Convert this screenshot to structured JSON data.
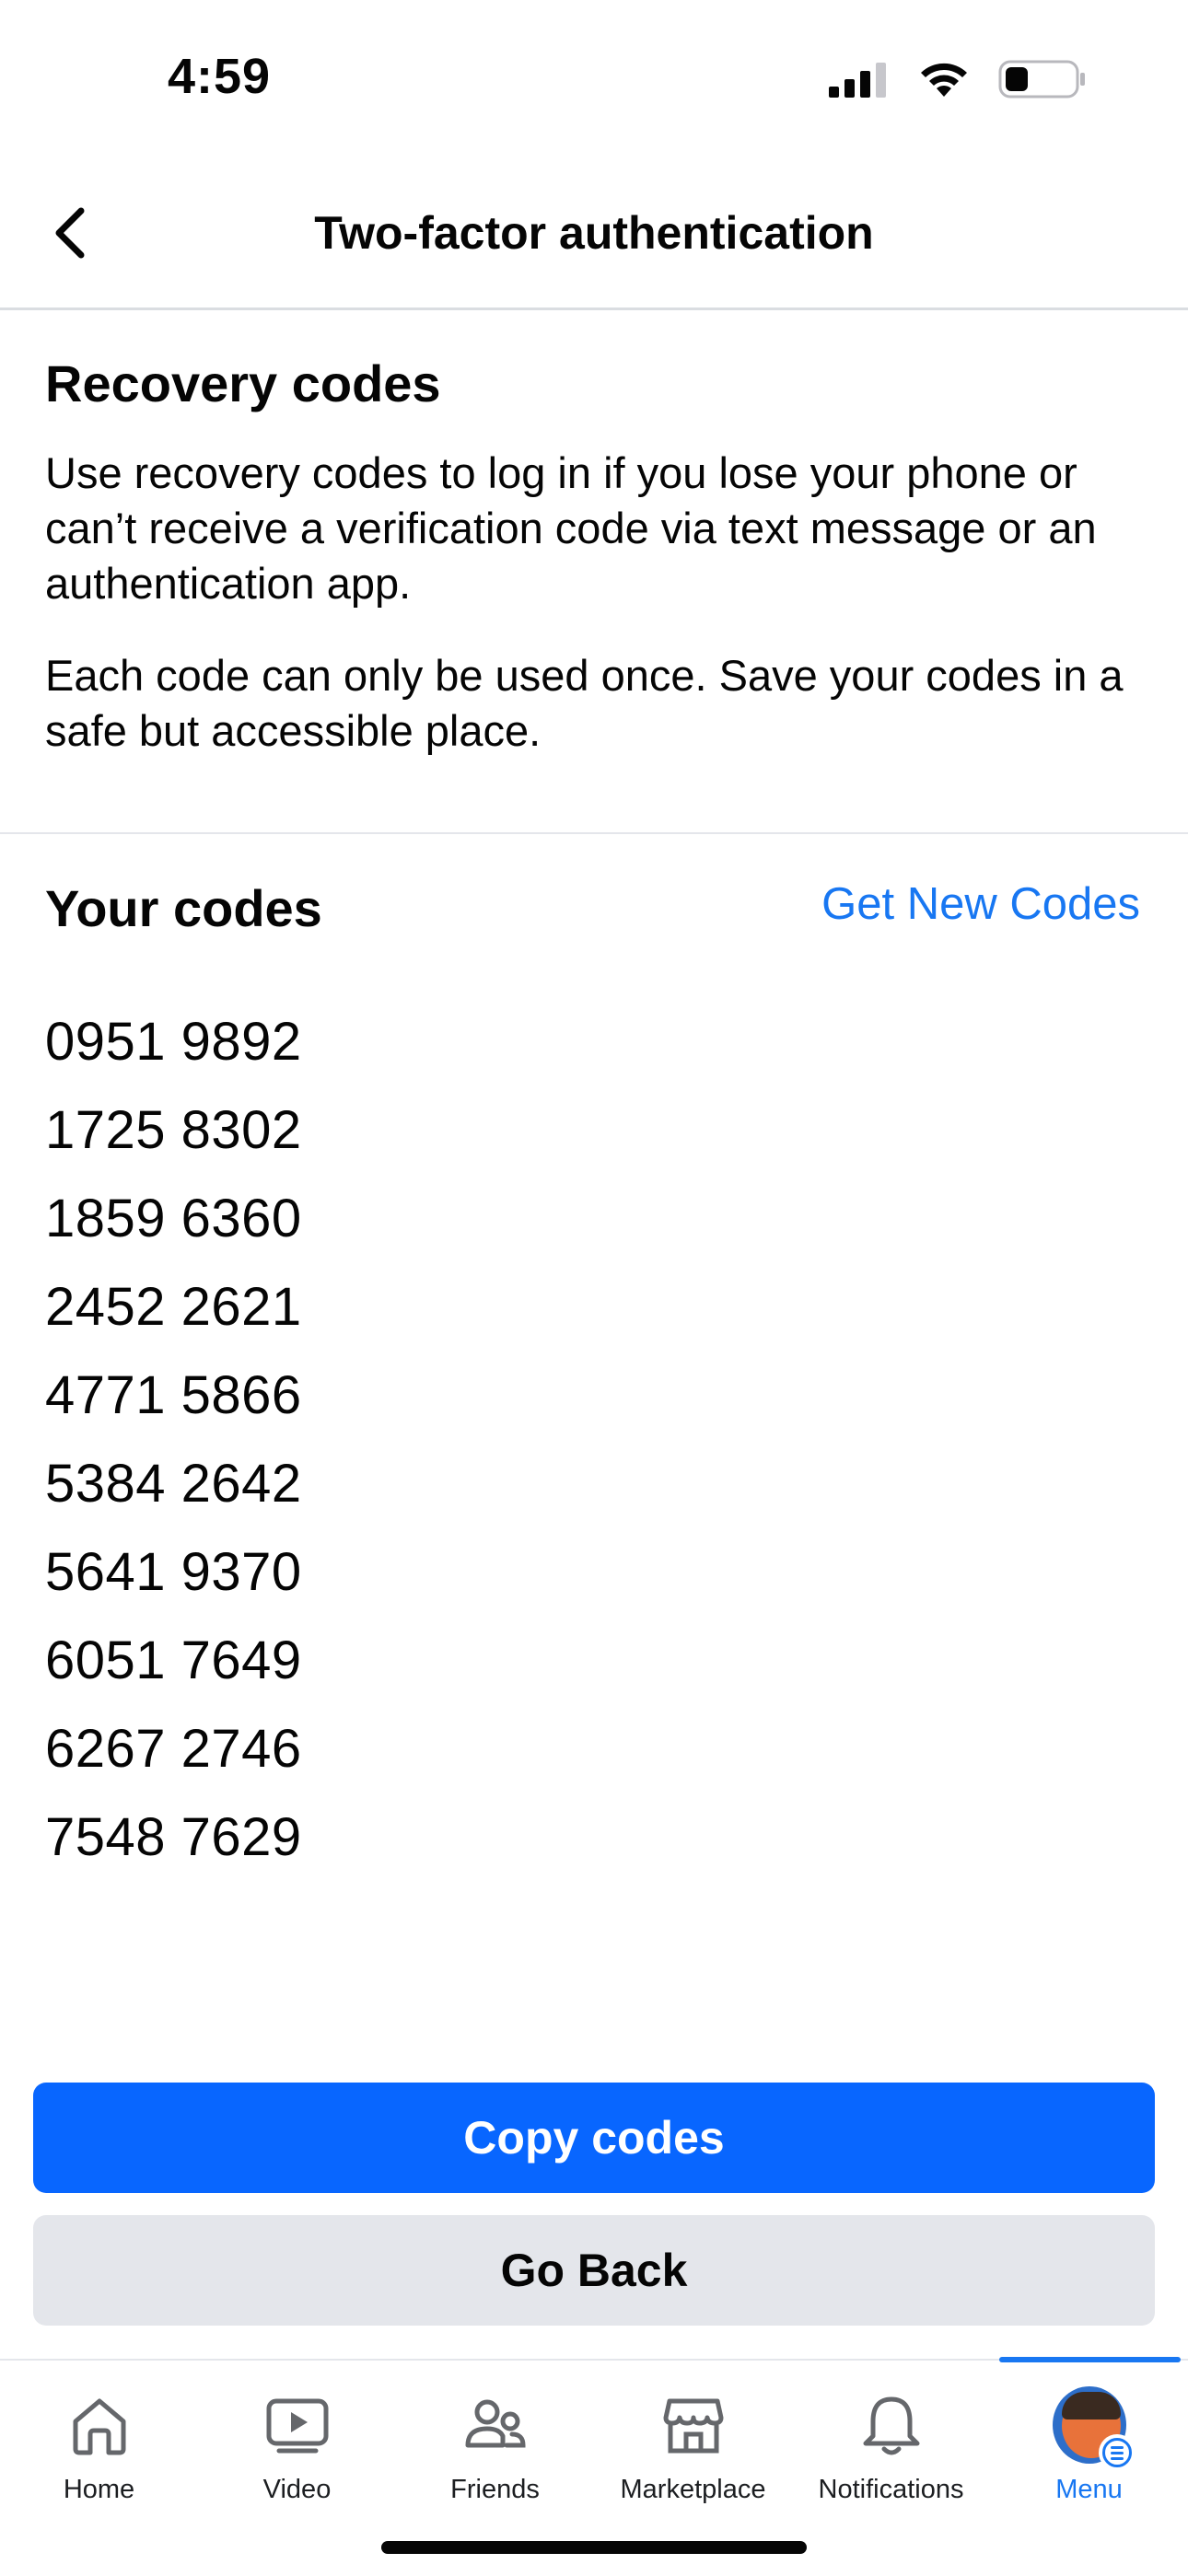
{
  "status_bar": {
    "time": "4:59"
  },
  "header": {
    "title": "Two-factor authentication"
  },
  "recovery": {
    "heading": "Recovery codes",
    "paragraph1": "Use recovery codes to log in if you lose your phone or can’t receive a verification code via text message or an authentication app.",
    "paragraph2": "Each code can only be used once. Save your codes in a safe but accessible place."
  },
  "codes": {
    "heading": "Your codes",
    "get_new_label": "Get New Codes",
    "items": [
      "0951 9892",
      "1725 8302",
      "1859 6360",
      "2452 2621",
      "4771 5866",
      "5384 2642",
      "5641 9370",
      "6051 7649",
      "6267 2746",
      "7548 7629"
    ]
  },
  "buttons": {
    "copy_label": "Copy codes",
    "back_label": "Go Back"
  },
  "tabs": [
    {
      "label": "Home",
      "icon": "home-icon"
    },
    {
      "label": "Video",
      "icon": "video-icon"
    },
    {
      "label": "Friends",
      "icon": "friends-icon"
    },
    {
      "label": "Marketplace",
      "icon": "marketplace-icon"
    },
    {
      "label": "Notifications",
      "icon": "bell-icon"
    },
    {
      "label": "Menu",
      "icon": "avatar",
      "active": true
    }
  ],
  "colors": {
    "accent": "#1877f2",
    "primary_button": "#0866ff",
    "secondary_button": "#e4e6eb"
  }
}
